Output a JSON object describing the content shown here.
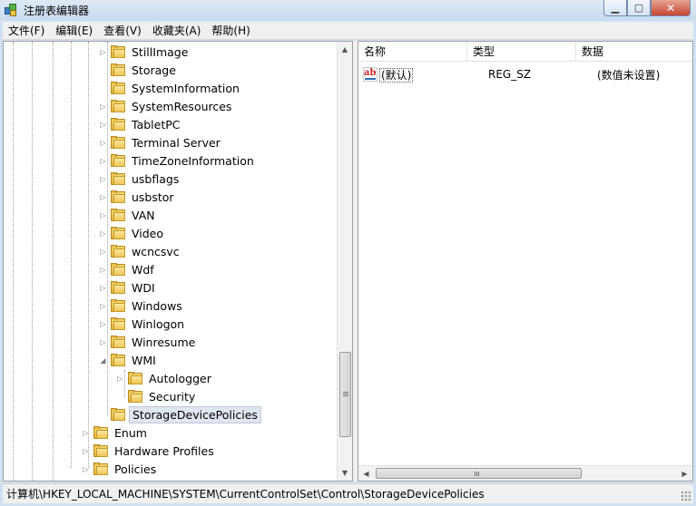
{
  "window": {
    "title": "注册表编辑器",
    "minimize_symbol": "▁",
    "maximize_symbol": "▢",
    "close_symbol": "✕"
  },
  "menu": [
    "文件(F)",
    "编辑(E)",
    "查看(V)",
    "收藏夹(A)",
    "帮助(H)"
  ],
  "tree": {
    "nodes": [
      {
        "label": "StillImage",
        "expander": "▷"
      },
      {
        "label": "Storage",
        "expander": ""
      },
      {
        "label": "SystemInformation",
        "expander": ""
      },
      {
        "label": "SystemResources",
        "expander": "▷"
      },
      {
        "label": "TabletPC",
        "expander": "▷"
      },
      {
        "label": "Terminal Server",
        "expander": "▷"
      },
      {
        "label": "TimeZoneInformation",
        "expander": "▷"
      },
      {
        "label": "usbflags",
        "expander": "▷"
      },
      {
        "label": "usbstor",
        "expander": "▷"
      },
      {
        "label": "VAN",
        "expander": "▷"
      },
      {
        "label": "Video",
        "expander": "▷"
      },
      {
        "label": "wcncsvc",
        "expander": "▷"
      },
      {
        "label": "Wdf",
        "expander": "▷"
      },
      {
        "label": "WDI",
        "expander": "▷"
      },
      {
        "label": "Windows",
        "expander": "▷"
      },
      {
        "label": "Winlogon",
        "expander": "▷"
      },
      {
        "label": "Winresume",
        "expander": "▷"
      },
      {
        "label": "WMI",
        "expander": "◢"
      },
      {
        "label": "Autologger",
        "expander": "▷"
      },
      {
        "label": "Security",
        "expander": ""
      },
      {
        "label": "StorageDevicePolicies",
        "expander": ""
      },
      {
        "label": "Enum",
        "expander": "▷"
      },
      {
        "label": "Hardware Profiles",
        "expander": "▷"
      },
      {
        "label": "Policies",
        "expander": "▷"
      }
    ],
    "selected": "StorageDevicePolicies"
  },
  "list": {
    "columns": [
      "名称",
      "类型",
      "数据"
    ],
    "rows": [
      {
        "name": "(默认)",
        "type": "REG_SZ",
        "data": "(数值未设置)",
        "icon": "ab-string-icon"
      }
    ],
    "icon_text": "ab"
  },
  "status": {
    "path": "计算机\\HKEY_LOCAL_MACHINE\\SYSTEM\\CurrentControlSet\\Control\\StorageDevicePolicies"
  }
}
